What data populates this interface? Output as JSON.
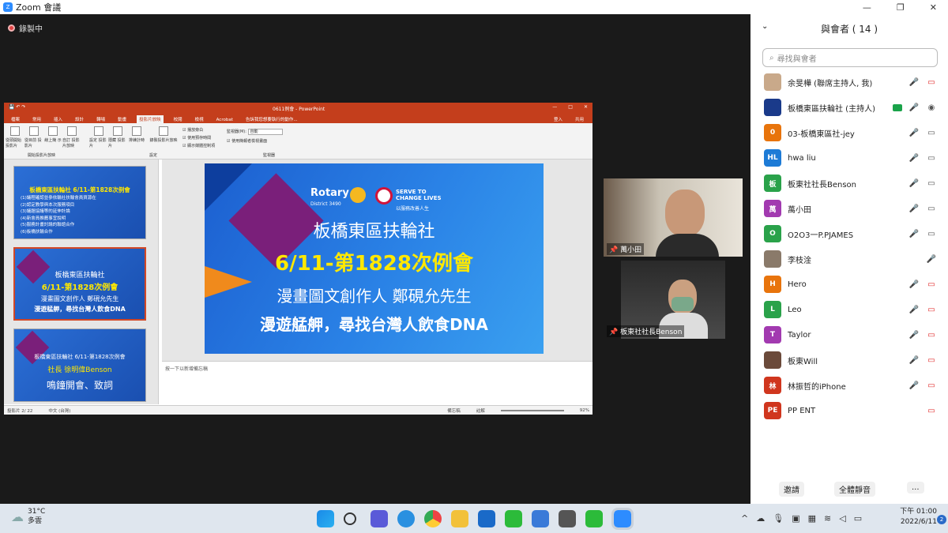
{
  "window": {
    "title": "Zoom 會議",
    "zoom_glyph": "Z"
  },
  "recording": {
    "label": "錄製中"
  },
  "ppt": {
    "title": "0611例會 - PowerPoint",
    "search_hint": "告訴我您想要執行的動作...",
    "user": "登入",
    "share": "共用",
    "tabs": [
      "檔案",
      "常用",
      "插入",
      "設計",
      "轉場",
      "動畫",
      "投影片放映",
      "校閱",
      "檢視",
      "Acrobat"
    ],
    "ribbon": {
      "btn1": "從頭開始 投影片",
      "btn2": "從目前 投影片",
      "btn3": "線上簡 示",
      "btn4": "自訂 投影片放映",
      "btn5": "設定 投影片",
      "btn6": "隱藏 投影片",
      "btn7": "排練計時",
      "btn8": "錄製投影片放映",
      "cb1": "播放旁白",
      "cb2": "使用預存時間",
      "cb3": "顯示媒體控制項",
      "monitor": "監視器(M):",
      "monitor_val": "自動",
      "cb4": "使用簡報者檢視畫面",
      "grp1": "開始投影片放映",
      "grp2": "設定",
      "grp3": "監視器"
    },
    "thumb1": {
      "title": "板橋東區扶輪社  6/11-第1828次例會",
      "lines": [
        "(1)議程確認並參依輪社扶輪會員資源在",
        "(2)認定教學與本次服務項目",
        "(3)議題協議等的延伸計論",
        "(4)新會員推薦事宜說明",
        "(5)服務計畫討論的聯誼合作",
        "(6)板橋扶輪合作"
      ]
    },
    "thumb2": {
      "l1": "板橋東區扶輪社",
      "l2": "6/11-第1828次例會",
      "l3": "漫畫圖文創作人 鄭硯允先生",
      "l4": "漫遊艋舺，尋找台灣人飲食DNA"
    },
    "thumb3": {
      "l1": "板橋東區扶輪社  6/11-第1828次例會",
      "l2": "社長 徐明偉Benson",
      "l3": "鳴鐘開會、致詞"
    },
    "slide": {
      "rotary": "Rotary",
      "district": "District 3490",
      "serve1": "SERVE TO",
      "serve2": "CHANGE LIVES",
      "serve3": "以服務改善人生",
      "club": "板橋東區扶輪社",
      "meeting": "6/11-第1828次例會",
      "speaker": "漫畫圖文創作人 鄭硯允先生",
      "topic": "漫遊艋舺，尋找台灣人飲食DNA"
    },
    "notes": "按一下以新增備忘稿",
    "status": {
      "slide": "投影片 2/ 22",
      "lang": "中文 (台灣)",
      "notes": "備忘稿",
      "comments": "註解",
      "zoom": "92%"
    }
  },
  "videos": [
    {
      "name": "萬小田"
    },
    {
      "name": "板東社社長Benson"
    }
  ],
  "panel": {
    "header": "與會者 ( 14 )",
    "search_placeholder": "尋找與會者",
    "invite": "邀請",
    "mute_all": "全體靜音",
    "more": "...",
    "participants": [
      {
        "name": "余旻樺 (聯席主持人, 我)",
        "avatar": "",
        "color": "#c9a98a",
        "mic": "off",
        "cam": "off"
      },
      {
        "name": "板橋東區扶輪社 (主持人)",
        "avatar": "",
        "color": "#1a3a8a",
        "mic": "on",
        "cam": "rec"
      },
      {
        "name": "03-板橋東區社-jey",
        "avatar": "0",
        "color": "#e8740c",
        "mic": "on",
        "cam": "on"
      },
      {
        "name": "hwa liu",
        "avatar": "HL",
        "color": "#1d7bd6",
        "mic": "on",
        "cam": "on"
      },
      {
        "name": "板東社社長Benson",
        "avatar": "板",
        "color": "#2aa24a",
        "mic": "on",
        "cam": "on"
      },
      {
        "name": "萬小田",
        "avatar": "萬",
        "color": "#a23ab0",
        "mic": "on",
        "cam": "on"
      },
      {
        "name": "O2O3一P.PJAMES",
        "avatar": "O",
        "color": "#2aa24a",
        "mic": "on",
        "cam": "on"
      },
      {
        "name": "李枝淦",
        "avatar": "",
        "color": "#8a7a6a",
        "mic": "on",
        "cam": "none"
      },
      {
        "name": "Hero",
        "avatar": "H",
        "color": "#e8740c",
        "mic": "off",
        "cam": "off"
      },
      {
        "name": "Leo",
        "avatar": "L",
        "color": "#2aa24a",
        "mic": "off",
        "cam": "off"
      },
      {
        "name": "Taylor",
        "avatar": "T",
        "color": "#a23ab0",
        "mic": "off",
        "cam": "off"
      },
      {
        "name": "板東Will",
        "avatar": "",
        "color": "#6b4a3a",
        "mic": "off",
        "cam": "off"
      },
      {
        "name": "林振哲的iPhone",
        "avatar": "林",
        "color": "#d0361e",
        "mic": "off",
        "cam": "off"
      },
      {
        "name": "PP ENT",
        "avatar": "PE",
        "color": "#d0361e",
        "mic": "none",
        "cam": "off"
      }
    ]
  },
  "taskbar": {
    "temp": "31°C",
    "weather": "多雲",
    "time": "下午 01:00",
    "date": "2022/6/11",
    "badge": "2"
  },
  "colors": {
    "ppt_red": "#c43e1c",
    "zoom_blue": "#2d8cff",
    "slide_blue": "#1c5fd0",
    "yellow": "#ffe800"
  }
}
